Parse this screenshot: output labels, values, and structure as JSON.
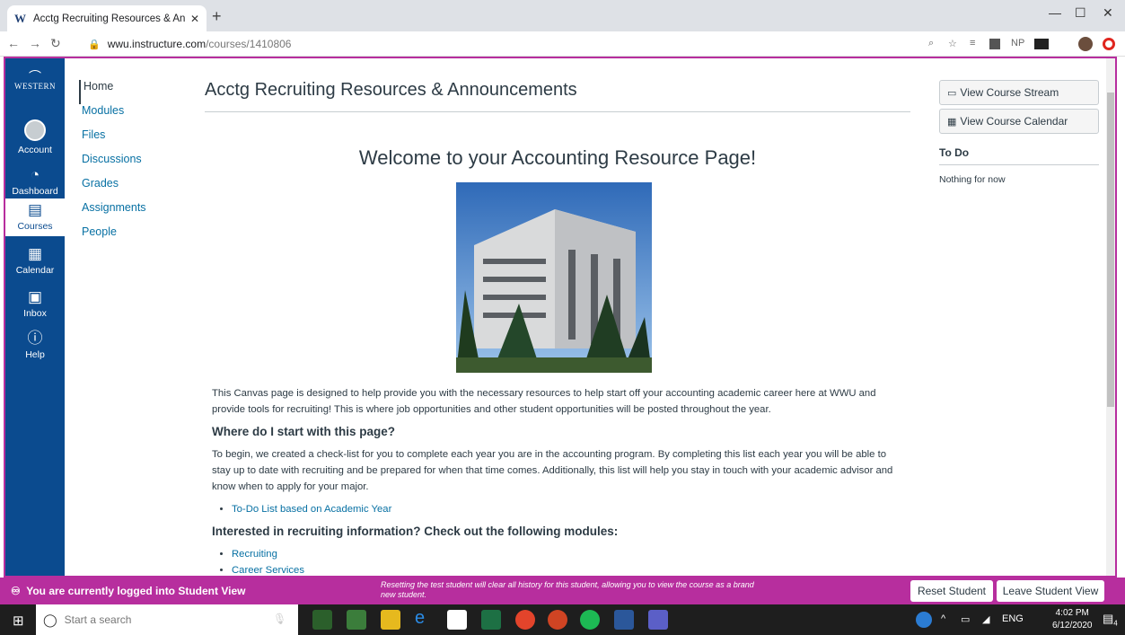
{
  "browser": {
    "tab_favicon": "W",
    "tab_title": "Acctg Recruiting Resources & An",
    "tab_close": "✕",
    "new_tab": "+",
    "url_domain": "wwu.instructure.com",
    "url_path": "/courses/1410806",
    "ext_np": "NP"
  },
  "global_nav": {
    "logo_text": "WESTERN",
    "items": [
      "Account",
      "Dashboard",
      "Courses",
      "Calendar",
      "Inbox",
      "Help"
    ]
  },
  "course_nav": [
    "Home",
    "Modules",
    "Files",
    "Discussions",
    "Grades",
    "Assignments",
    "People"
  ],
  "page": {
    "title": "Acctg Recruiting Resources & Announcements",
    "welcome": "Welcome to your Accounting Resource Page!",
    "intro": "This Canvas page is designed to help provide you with the necessary resources to help start off your accounting academic career here at WWU and provide tools for recruiting! This is where job opportunities and other student opportunities will be posted throughout the year.",
    "h1": "Where do I start with this page?",
    "p2": "To begin, we created a check-list for you to complete each year you are in the accounting program. By completing this list each year you will be able to stay up to date with recruiting and be prepared for when that time comes. Additionally, this list will help you stay in touch with your academic advisor and know when to apply for your major.",
    "link1": "To-Do List based on Academic Year",
    "h2": "Interested in recruiting information? Check out the following modules:",
    "link2": "Recruiting",
    "link3": "Career Services"
  },
  "sidebar": {
    "stream_button": "View Course Stream",
    "calendar_button": "View Course Calendar",
    "todo_heading": "To Do",
    "todo_empty": "Nothing for now"
  },
  "student_view": {
    "message": "You are currently logged into Student View",
    "note": "Resetting the test student will clear all history for this student, allowing you to view the course as a brand new student.",
    "reset_button": "Reset Student",
    "leave_button": "Leave Student View"
  },
  "taskbar": {
    "search_placeholder": "Start a search",
    "lang": "ENG",
    "time": "4:02 PM",
    "date": "6/12/2020",
    "notif_count": "4"
  },
  "colors": {
    "canvas_nav": "#0b4b8f",
    "student_view": "#b72e9e",
    "link": "#0770a3"
  }
}
